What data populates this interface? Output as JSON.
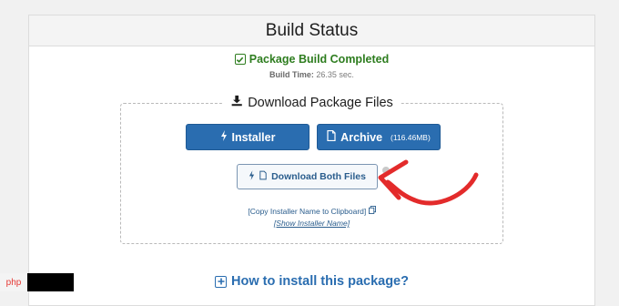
{
  "header": {
    "title": "Build Status"
  },
  "status": {
    "completed_label": "Package Build Completed",
    "build_time_label": "Build Time:",
    "build_time_value": "26.35 sec."
  },
  "download": {
    "legend": "Download Package Files",
    "installer_label": "Installer",
    "archive_label": "Archive",
    "archive_size": "(116.46MB)",
    "both_label": "Download Both Files",
    "copy_link": "[Copy Installer Name to Clipboard]",
    "show_link": "[Show Installer Name]"
  },
  "help": {
    "howto_label": "How to install this package?"
  },
  "watermark": {
    "text": "php"
  },
  "colors": {
    "success": "#2e7d1f",
    "primary": "#2a6db0",
    "annotation_arrow": "#e32b2b"
  },
  "icons": {
    "status": "check-square-icon",
    "legend": "download-icon",
    "installer": "bolt-icon",
    "archive": "file-archive-icon",
    "both": [
      "bolt-icon",
      "file-icon"
    ],
    "copy": "copy-icon",
    "howto": "plus-square-icon"
  }
}
